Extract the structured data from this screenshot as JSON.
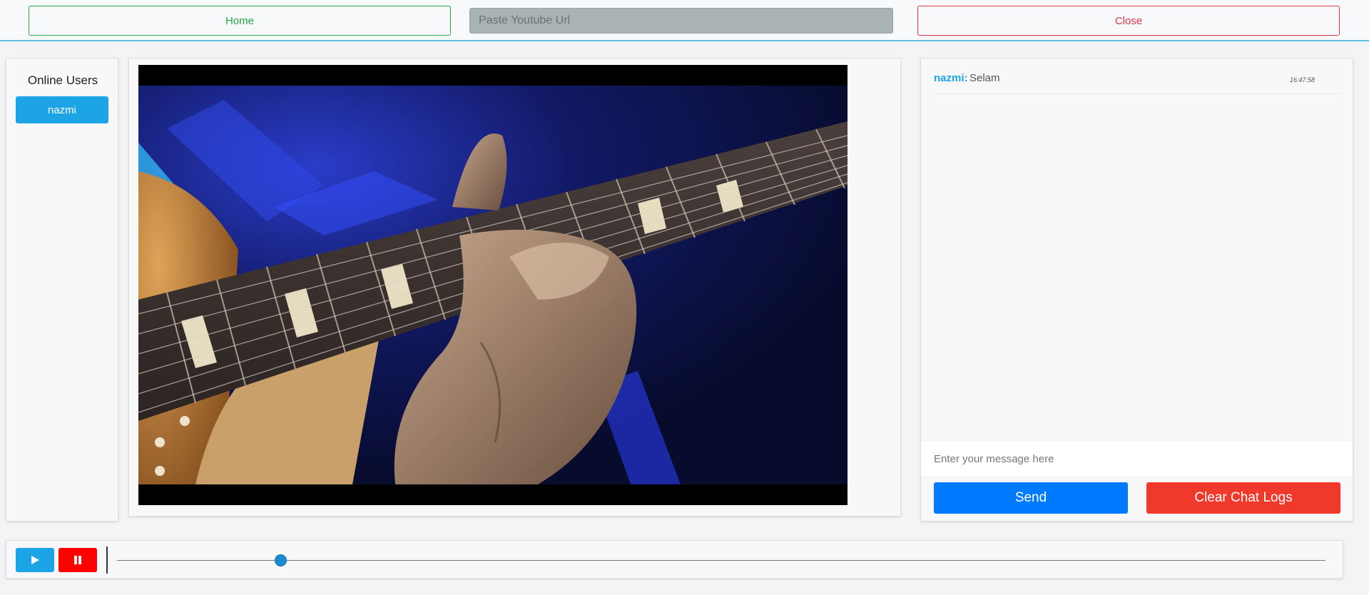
{
  "header": {
    "home_label": "Home",
    "url_placeholder": "Paste Youtube Url",
    "close_label": "Close"
  },
  "users": {
    "title": "Online Users",
    "list": [
      "nazmi"
    ]
  },
  "chat": {
    "messages": [
      {
        "user": "nazmi:",
        "text": "Selam",
        "time": "16:47:58"
      }
    ],
    "input_placeholder": "Enter your message here",
    "send_label": "Send",
    "clear_label": "Clear Chat Logs"
  },
  "player": {
    "progress_fraction": 0.135,
    "play_icon": "play-icon",
    "pause_icon": "pause-icon"
  },
  "colors": {
    "accent_blue": "#1da4e6",
    "send_blue": "#007bff",
    "danger_red": "#f0392b",
    "pause_red": "#ff0000",
    "home_green": "#28a745",
    "close_red": "#dc3545"
  }
}
